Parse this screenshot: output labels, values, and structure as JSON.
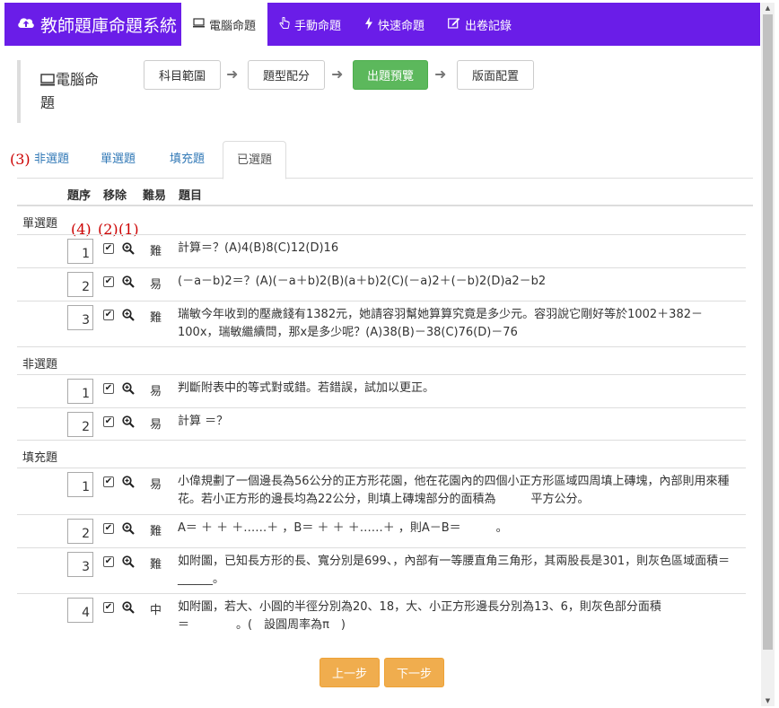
{
  "brand": {
    "title": "教師題庫命題系統",
    "icon": "cloud-upload-icon"
  },
  "nav": [
    {
      "label": "電腦命題",
      "icon": "monitor-icon",
      "active": true
    },
    {
      "label": "手動命題",
      "icon": "hand-pointer-icon",
      "active": false
    },
    {
      "label": "快速命題",
      "icon": "bolt-icon",
      "active": false
    },
    {
      "label": "出卷記錄",
      "icon": "edit-icon",
      "active": false
    }
  ],
  "steps": {
    "title": "電腦命題",
    "items": [
      "科目範圍",
      "題型配分",
      "出題預覽",
      "版面配置"
    ],
    "current": "出題預覽"
  },
  "annotations": {
    "a1": "(1)",
    "a2": "(2)",
    "a3": "(3)",
    "a4": "(4)"
  },
  "tabs": [
    "非選題",
    "單選題",
    "填充題",
    "已選題"
  ],
  "active_tab": "已選題",
  "headers": {
    "order": "題序",
    "remove": "移除",
    "difficulty": "難易",
    "question": "題目"
  },
  "groups": [
    {
      "name": "單選題",
      "rows": [
        {
          "order": "1",
          "checked": true,
          "level": "難",
          "text": "計算＝？(A)4(B)8(C)12(D)16"
        },
        {
          "order": "2",
          "checked": true,
          "level": "易",
          "text": "(－a－b)2＝？(A)(－a＋b)2(B)(a＋b)2(C)(－a)2＋(－b)2(D)a2－b2"
        },
        {
          "order": "3",
          "checked": true,
          "level": "難",
          "text": "瑞敏今年收到的壓歲錢有1382元，她請容羽幫她算算究竟是多少元。容羽說它剛好等於1002＋382－100x，瑞敏繼續問，那x是多少呢？(A)38(B)－38(C)76(D)－76"
        }
      ]
    },
    {
      "name": "非選題",
      "rows": [
        {
          "order": "1",
          "checked": true,
          "level": "易",
          "text": "判斷附表中的等式對或錯。若錯誤，試加以更正。"
        },
        {
          "order": "2",
          "checked": true,
          "level": "易",
          "text": "計算 ＝？"
        }
      ]
    },
    {
      "name": "填充題",
      "rows": [
        {
          "order": "1",
          "checked": true,
          "level": "易",
          "text": "小偉規劃了一個邊長為56公分的正方形花園，他在花園內的四個小正方形區域四周填上磚塊，內部則用來種花。若小正方形的邊長均為22公分，則填上磚塊部分的面積為　　　平方公分。"
        },
        {
          "order": "2",
          "checked": true,
          "level": "難",
          "text": "A＝ ＋ ＋ ＋……＋ ，B＝ ＋ ＋ ＋……＋ ，則A－B＝　　　。"
        },
        {
          "order": "3",
          "checked": true,
          "level": "難",
          "text": "如附圖，已知長方形的長、寬分別是699、，內部有一等腰直角三角形，其兩股長是301，則灰色區域面積＝______。"
        },
        {
          "order": "4",
          "checked": true,
          "level": "中",
          "text": "如附圖，若大、小圓的半徑分別為20、18，大、小正方形邊長分別為13、6，則灰色部分面積　＝　　　　。(　設圓周率為π　)"
        }
      ]
    }
  ],
  "buttons": {
    "prev": "上一步",
    "next": "下一步"
  },
  "colors": {
    "navbar": "#6a1de8",
    "current_step": "#5cb85c",
    "action_button": "#f0ad4e",
    "annotation": "#cc0000"
  }
}
